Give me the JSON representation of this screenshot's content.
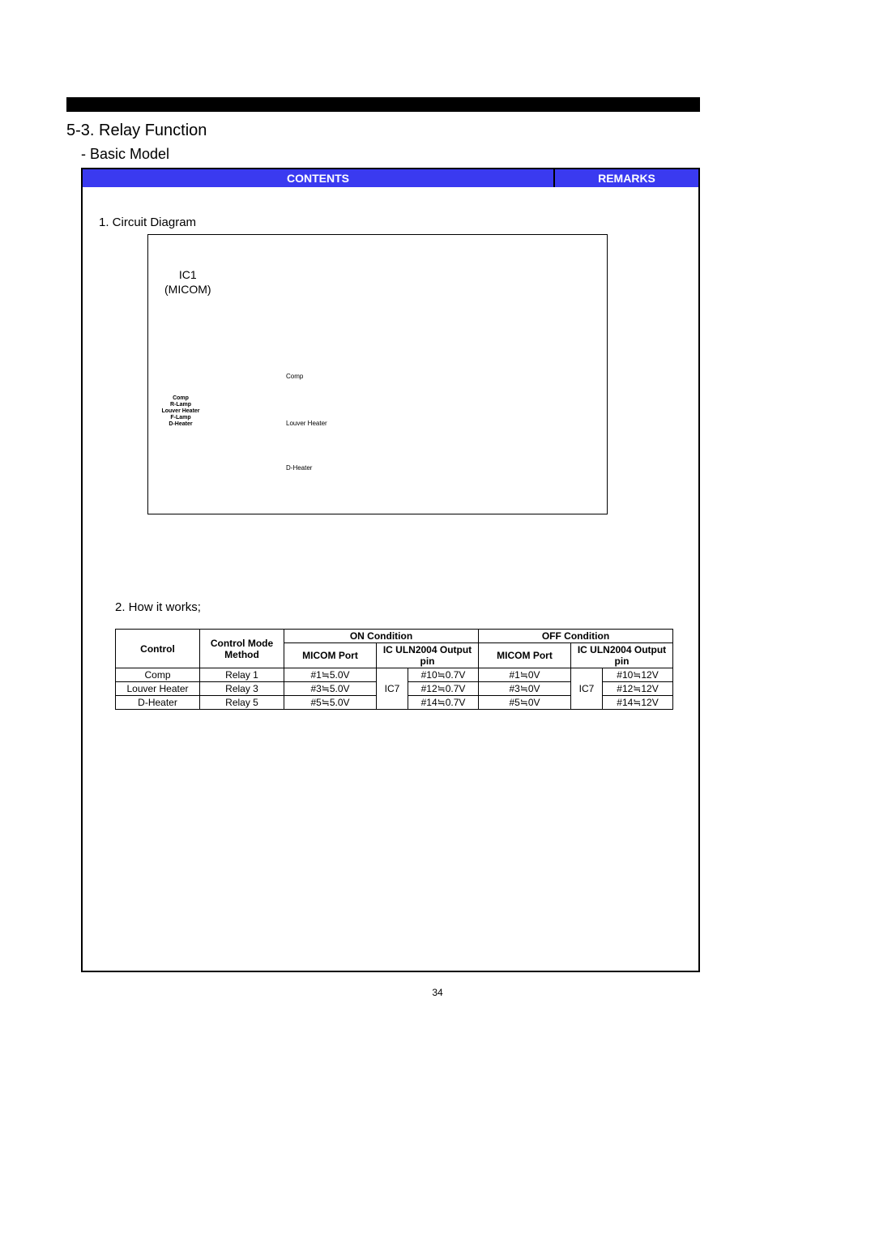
{
  "approx": "≒",
  "page_number": "34",
  "section_title": "5-3. Relay Function",
  "subtitle": "- Basic Model",
  "header": {
    "contents": "CONTENTS",
    "remarks": "REMARKS"
  },
  "sec1": {
    "label": "1. Circuit Diagram",
    "ic1_line1": "IC1",
    "ic1_line2": "(MICOM)",
    "signals": [
      "Comp",
      "R-Lamp",
      "Louver Heater",
      "F-Lamp",
      "D-Heater"
    ],
    "right_labels": {
      "comp": "Comp",
      "louver": "Louver Heater",
      "dheater": "D-Heater"
    }
  },
  "sec2": {
    "label": "2. How it works;",
    "headers": {
      "control": "Control",
      "mode": "Control Mode Method",
      "on_cond": "ON Condition",
      "off_cond": "OFF Condition",
      "micom_port": "MICOM Port",
      "ic_uln": "IC ULN2004 Output pin"
    },
    "ic7": "IC7",
    "rows": [
      {
        "control": "Comp",
        "mode": "Relay 1",
        "on_micom": "#1≒5.0V",
        "on_pin": "#10≒0.7V",
        "off_micom": "#1≒0V",
        "off_pin": "#10≒12V"
      },
      {
        "control": "Louver Heater",
        "mode": "Relay 3",
        "on_micom": "#3≒5.0V",
        "on_pin": "#12≒0.7V",
        "off_micom": "#3≒0V",
        "off_pin": "#12≒12V"
      },
      {
        "control": "D-Heater",
        "mode": "Relay 5",
        "on_micom": "#5≒5.0V",
        "on_pin": "#14≒0.7V",
        "off_micom": "#5≒0V",
        "off_pin": "#14≒12V"
      }
    ]
  }
}
